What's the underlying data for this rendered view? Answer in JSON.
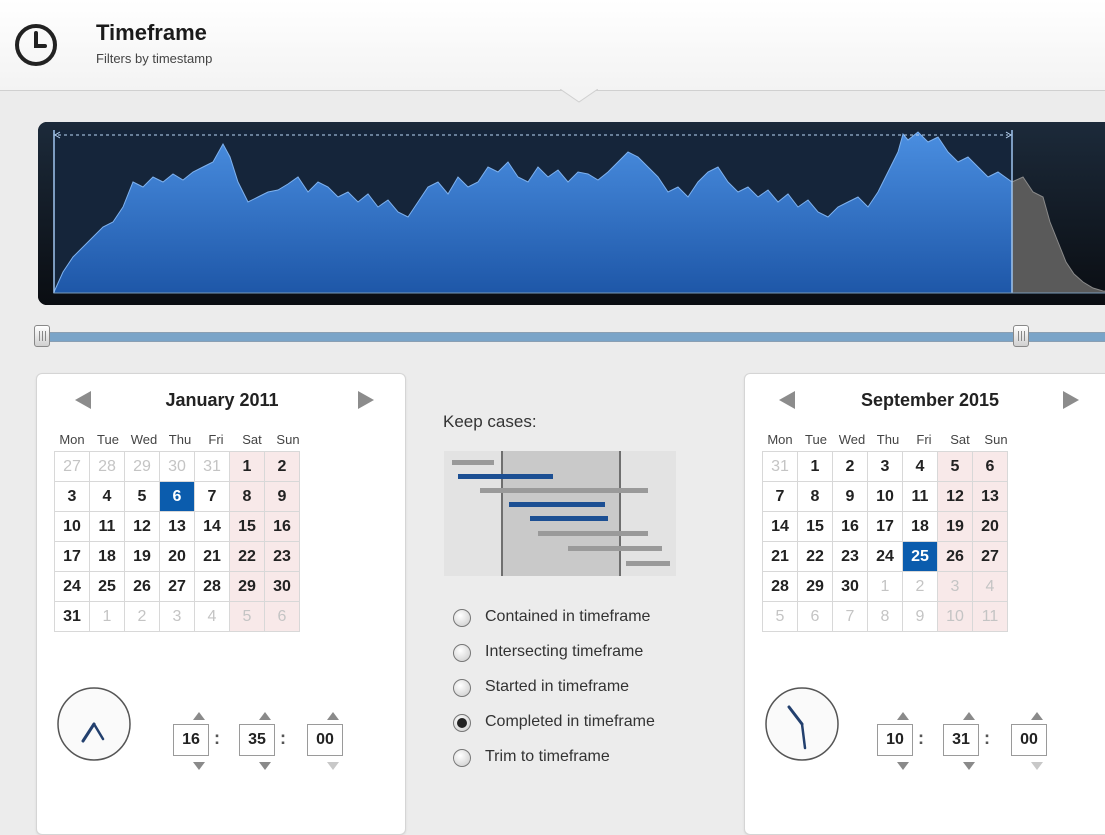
{
  "header": {
    "icon": "clock-icon",
    "title": "Timeframe",
    "subtitle": "Filters by timestamp"
  },
  "colors": {
    "accent": "#0b5cad",
    "histogram_fill": "#2f6fc4",
    "histogram_outside": "#555555",
    "weekend_bg": "#f8e9e9"
  },
  "start_calendar": {
    "title": "January 2011",
    "weekdays": [
      "Mon",
      "Tue",
      "Wed",
      "Thu",
      "Fri",
      "Sat",
      "Sun"
    ],
    "weeks": [
      [
        "27",
        "28",
        "29",
        "30",
        "31",
        "1",
        "2"
      ],
      [
        "3",
        "4",
        "5",
        "6",
        "7",
        "8",
        "9"
      ],
      [
        "10",
        "11",
        "12",
        "13",
        "14",
        "15",
        "16"
      ],
      [
        "17",
        "18",
        "19",
        "20",
        "21",
        "22",
        "23"
      ],
      [
        "24",
        "25",
        "26",
        "27",
        "28",
        "29",
        "30"
      ],
      [
        "31",
        "1",
        "2",
        "3",
        "4",
        "5",
        "6"
      ]
    ],
    "selected_day": "6",
    "time": {
      "hours": "16",
      "minutes": "35",
      "seconds": "00"
    }
  },
  "end_calendar": {
    "title": "September 2015",
    "weekdays": [
      "Mon",
      "Tue",
      "Wed",
      "Thu",
      "Fri",
      "Sat",
      "Sun"
    ],
    "weeks": [
      [
        "31",
        "1",
        "2",
        "3",
        "4",
        "5",
        "6"
      ],
      [
        "7",
        "8",
        "9",
        "10",
        "11",
        "12",
        "13"
      ],
      [
        "14",
        "15",
        "16",
        "17",
        "18",
        "19",
        "20"
      ],
      [
        "21",
        "22",
        "23",
        "24",
        "25",
        "26",
        "27"
      ],
      [
        "28",
        "29",
        "30",
        "1",
        "2",
        "3",
        "4"
      ],
      [
        "5",
        "6",
        "7",
        "8",
        "9",
        "10",
        "11"
      ]
    ],
    "selected_day": "25",
    "time": {
      "hours": "10",
      "minutes": "31",
      "seconds": "00"
    }
  },
  "keep_cases": {
    "label": "Keep cases:",
    "options": [
      {
        "label": "Contained in timeframe",
        "checked": false
      },
      {
        "label": "Intersecting timeframe",
        "checked": false
      },
      {
        "label": "Started in timeframe",
        "checked": false
      },
      {
        "label": "Completed in timeframe",
        "checked": true
      },
      {
        "label": "Trim to timeframe",
        "checked": false
      }
    ]
  }
}
